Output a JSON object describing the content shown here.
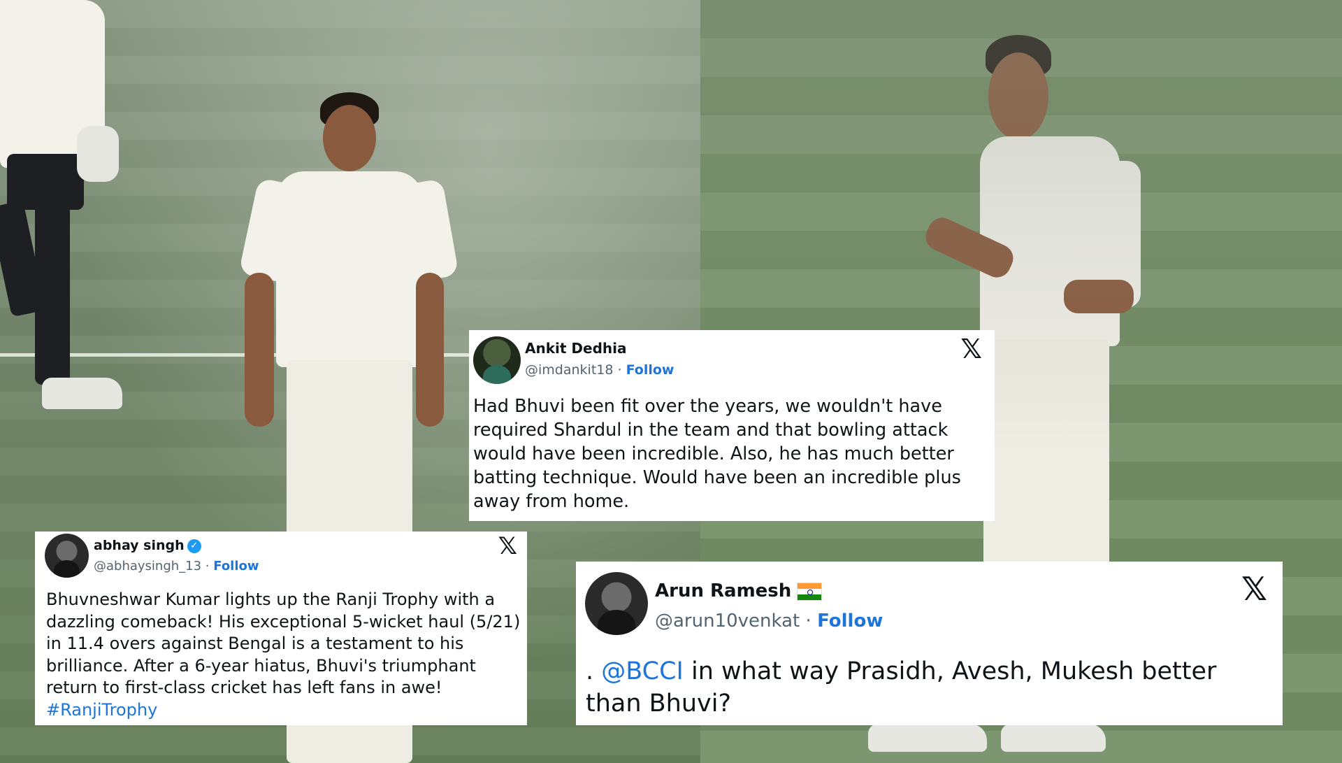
{
  "tweets": [
    {
      "name": "Ankit Dedhia",
      "handle": "@imdankit18",
      "separator": " · ",
      "follow": "Follow",
      "x_icon": "𝕏",
      "text": "Had Bhuvi been fit over the years, we wouldn't have required Shardul in the team and that bowling attack would have been incredible. Also, he has much better batting technique. Would have been an incredible plus away from home."
    },
    {
      "name": "abhay singh",
      "verified_icon": "✓",
      "handle": "@abhaysingh_13",
      "separator": " · ",
      "follow": "Follow",
      "x_icon": "𝕏",
      "text": "Bhuvneshwar Kumar lights up the Ranji Trophy with a dazzling comeback! His exceptional 5-wicket haul (5/21) in 11.4 overs against Bengal is a testament to his brilliance. After a 6-year hiatus, Bhuvi's triumphant return to first-class cricket has left fans in awe!",
      "hashtag": "#RanjiTrophy"
    },
    {
      "name": "Arun Ramesh",
      "flag_icon": "india-flag-icon",
      "handle": "@arun10venkat",
      "separator": " · ",
      "follow": "Follow",
      "x_icon": "𝕏",
      "text_prefix": ". ",
      "mention": "@BCCI",
      "text": " in what way Prasidh, Avesh, Mukesh better than Bhuvi?"
    }
  ],
  "colors": {
    "link": "#1d74d9",
    "card_bg": "#ffffff",
    "pitch_green": "#6f8a62"
  }
}
